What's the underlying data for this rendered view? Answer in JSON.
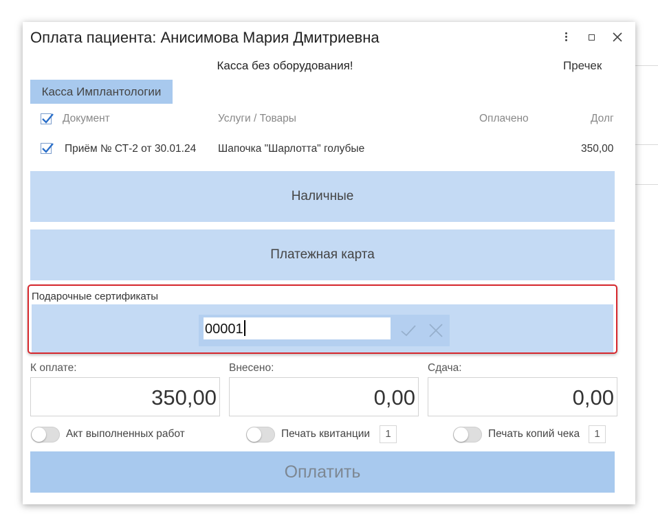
{
  "dialog": {
    "title": "Оплата пациента: Анисимова Мария Дмитриевна",
    "subtitle": "Касса без оборудования!",
    "receipt_link": "Пречек"
  },
  "cashbox_tab": "Касса Имплантологии",
  "table": {
    "headers": {
      "document": "Документ",
      "services": "Услуги / Товары",
      "paid": "Оплачено",
      "debt": "Долг"
    },
    "header_checked": true,
    "rows": [
      {
        "checked": true,
        "document": "Приём № СТ-2 от 30.01.24",
        "services": "Шапочка \"Шарлотта\" голубые",
        "paid": "",
        "debt": "350,00"
      }
    ]
  },
  "payment_methods": {
    "cash": "Наличные",
    "card": "Платежная карта"
  },
  "gift_certificates": {
    "label": "Подарочные сертификаты",
    "input_value": "00001"
  },
  "summary": {
    "to_pay_label": "К оплате:",
    "to_pay_value": "350,00",
    "deposited_label": "Внесено:",
    "deposited_value": "0,00",
    "change_label": "Сдача:",
    "change_value": "0,00"
  },
  "options": {
    "act_label": "Акт выполненных работ",
    "receipt_print_label": "Печать квитанции",
    "receipt_print_copies": "1",
    "check_copies_label": "Печать копий чека",
    "check_copies_count": "1"
  },
  "pay_button": "Оплатить",
  "colors": {
    "accent": "#a8c9ee",
    "panel": "#c4daf4",
    "highlight": "#d6262c"
  }
}
